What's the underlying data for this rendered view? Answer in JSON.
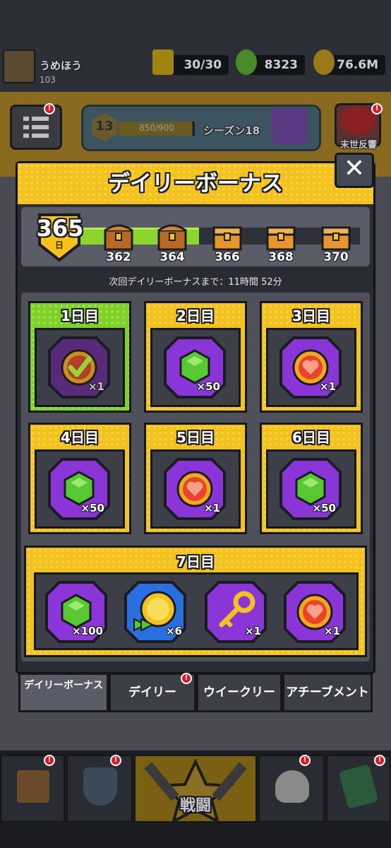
{
  "player": {
    "name": "うめほう",
    "level": "103"
  },
  "stats": {
    "energy": "30/30",
    "gems": "8323",
    "coins": "76.6M"
  },
  "season": {
    "level": "13",
    "xp": "850/900",
    "label": "シーズン18"
  },
  "event_button": {
    "label": "末世反響"
  },
  "dialog": {
    "title": "デイリーボーナス",
    "close_label": "✕",
    "current_day": {
      "value": "365",
      "unit": "日"
    },
    "milestones": [
      "362",
      "364",
      "366",
      "368",
      "370"
    ],
    "timer_text": "次回デイリーボーナスまで：11時間 52分",
    "days": [
      {
        "label": "1日目",
        "item": "check-badge-icon",
        "qty": "×1",
        "claimed": true
      },
      {
        "label": "2日目",
        "item": "gem-icon",
        "qty": "×50"
      },
      {
        "label": "3日目",
        "item": "heart-coin-icon",
        "qty": "×1"
      },
      {
        "label": "4日目",
        "item": "gem-icon",
        "qty": "×50"
      },
      {
        "label": "5日目",
        "item": "heart-coin-icon",
        "qty": "×1"
      },
      {
        "label": "6日目",
        "item": "gem-icon",
        "qty": "×50"
      }
    ],
    "day7": {
      "label": "7日目",
      "items": [
        {
          "item": "gem-icon",
          "qty": "×100"
        },
        {
          "item": "speed-coin-icon",
          "qty": "×6"
        },
        {
          "item": "key-icon",
          "qty": "×1"
        },
        {
          "item": "heart-coin-icon",
          "qty": "×1"
        }
      ]
    }
  },
  "tabs": [
    {
      "label": "デイリーボーナス",
      "active": true
    },
    {
      "label": "デイリー",
      "badge": "!"
    },
    {
      "label": "ウイークリー"
    },
    {
      "label": "アチーブメント"
    }
  ],
  "bottom_nav": {
    "battle_label": "戦闘"
  },
  "colors": {
    "gold": "#f4c21c",
    "green": "#7fd12a",
    "purple": "#8a35d8",
    "blue": "#2a6fe0",
    "badge_red": "#d21e2c"
  }
}
